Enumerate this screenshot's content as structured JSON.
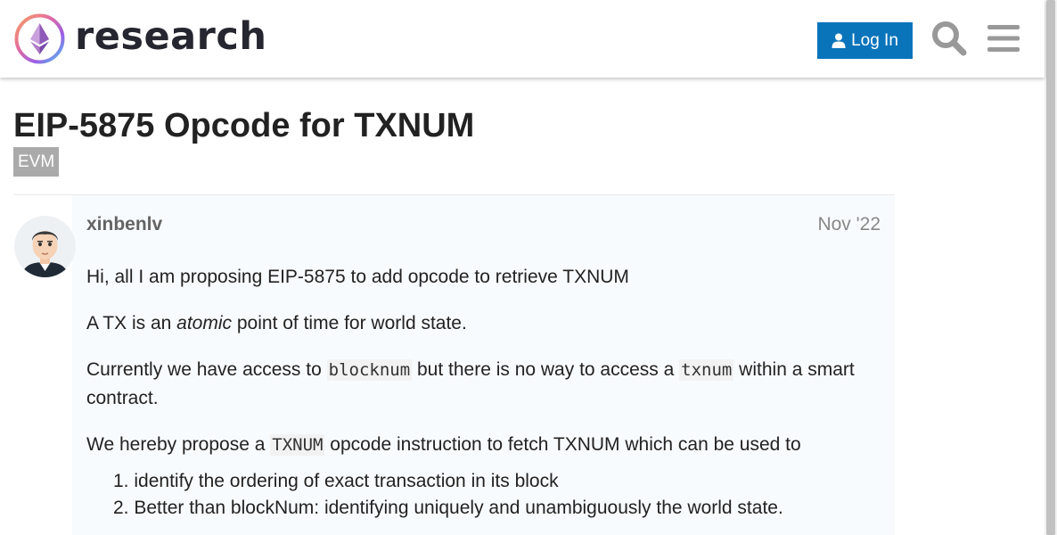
{
  "header": {
    "site_name": "research",
    "login_label": "Log In",
    "accent_color": "#0a74bb"
  },
  "topic": {
    "title": "EIP-5875 Opcode for TXNUM",
    "category": "EVM"
  },
  "post": {
    "author": "xinbenlv",
    "date": "Nov '22",
    "p1": "Hi, all I am proposing EIP-5875 to add opcode to retrieve TXNUM",
    "p2_before": "A TX is an ",
    "p2_em": "atomic",
    "p2_after": " point of time for world state.",
    "p3_before": "Currently we have access to ",
    "p3_code1": "blocknum",
    "p3_mid": " but there is no way to access a ",
    "p3_code2": "txnum",
    "p3_after": " within a smart contract.",
    "p4_before": "We hereby propose a ",
    "p4_code": "TXNUM",
    "p4_after": " opcode instruction to fetch TXNUM which can be used to",
    "list": [
      {
        "num": "1.",
        "text": "identify the ordering of exact transaction in its block"
      },
      {
        "num": "2.",
        "text": "Better than blockNum: identifying uniquely and unambiguously the world state."
      }
    ]
  },
  "icons": [
    "ethereum-logo-icon",
    "user-icon",
    "search-icon",
    "menu-icon"
  ]
}
